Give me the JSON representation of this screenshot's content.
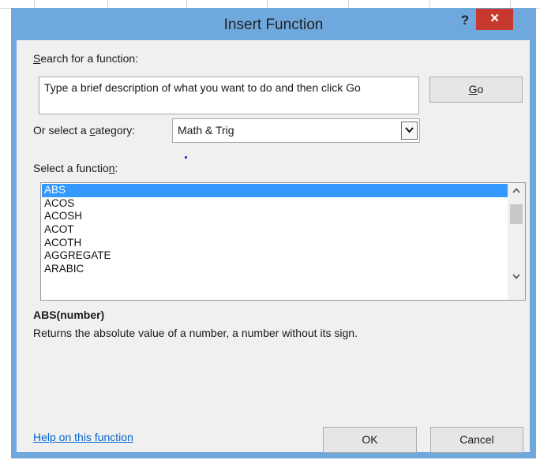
{
  "dialog": {
    "title": "Insert Function",
    "help_glyph": "?",
    "close_glyph": "×"
  },
  "search": {
    "label_accel": "S",
    "label_rest": "earch for a function:",
    "value": "Type a brief description of what you want to do and then click Go",
    "go_accel": "G",
    "go_rest": "o"
  },
  "category": {
    "label_pre": "Or select a ",
    "label_accel": "c",
    "label_post": "ategory:",
    "selected": "Math & Trig"
  },
  "functions": {
    "label_pre": "Select a functio",
    "label_accel": "n",
    "label_post": ":",
    "items": [
      "ABS",
      "ACOS",
      "ACOSH",
      "ACOT",
      "ACOTH",
      "AGGREGATE",
      "ARABIC"
    ],
    "selected_index": 0
  },
  "details": {
    "signature": "ABS(number)",
    "description": "Returns the absolute value of a number, a number without its sign."
  },
  "footer": {
    "help_link": "Help on this function",
    "ok": "OK",
    "cancel": "Cancel"
  },
  "colors": {
    "frame": "#6ea8dd",
    "close": "#c7392f",
    "selection": "#3399ff",
    "link": "#0066cc"
  }
}
